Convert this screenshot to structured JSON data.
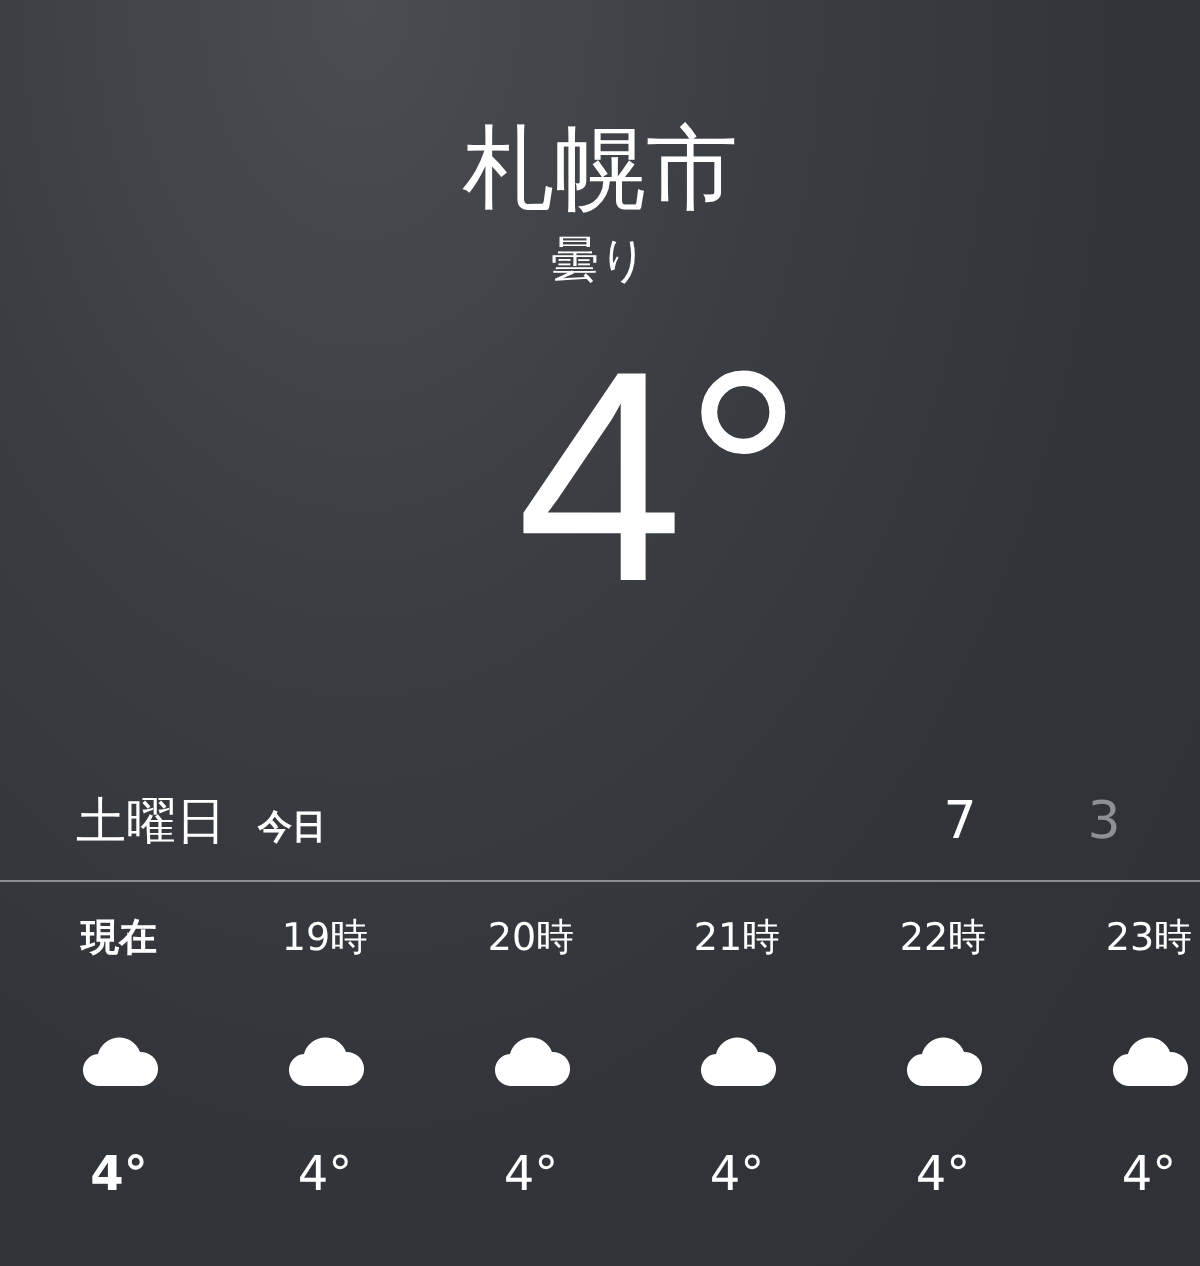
{
  "location": {
    "city": "札幌市",
    "condition": "曇り",
    "temperature": "4°"
  },
  "today": {
    "weekday": "土曜日",
    "label": "今日",
    "high": "7",
    "low": "3"
  },
  "hourly": [
    {
      "kind": "now",
      "time": "現在",
      "temperature": "4°"
    },
    {
      "kind": "hour",
      "time": "19時",
      "temperature": "4°"
    },
    {
      "kind": "hour",
      "time": "20時",
      "temperature": "4°"
    },
    {
      "kind": "hour",
      "time": "21時",
      "temperature": "4°"
    },
    {
      "kind": "hour",
      "time": "22時",
      "temperature": "4°"
    },
    {
      "kind": "hour",
      "time": "23時",
      "temperature": "4°"
    }
  ]
}
